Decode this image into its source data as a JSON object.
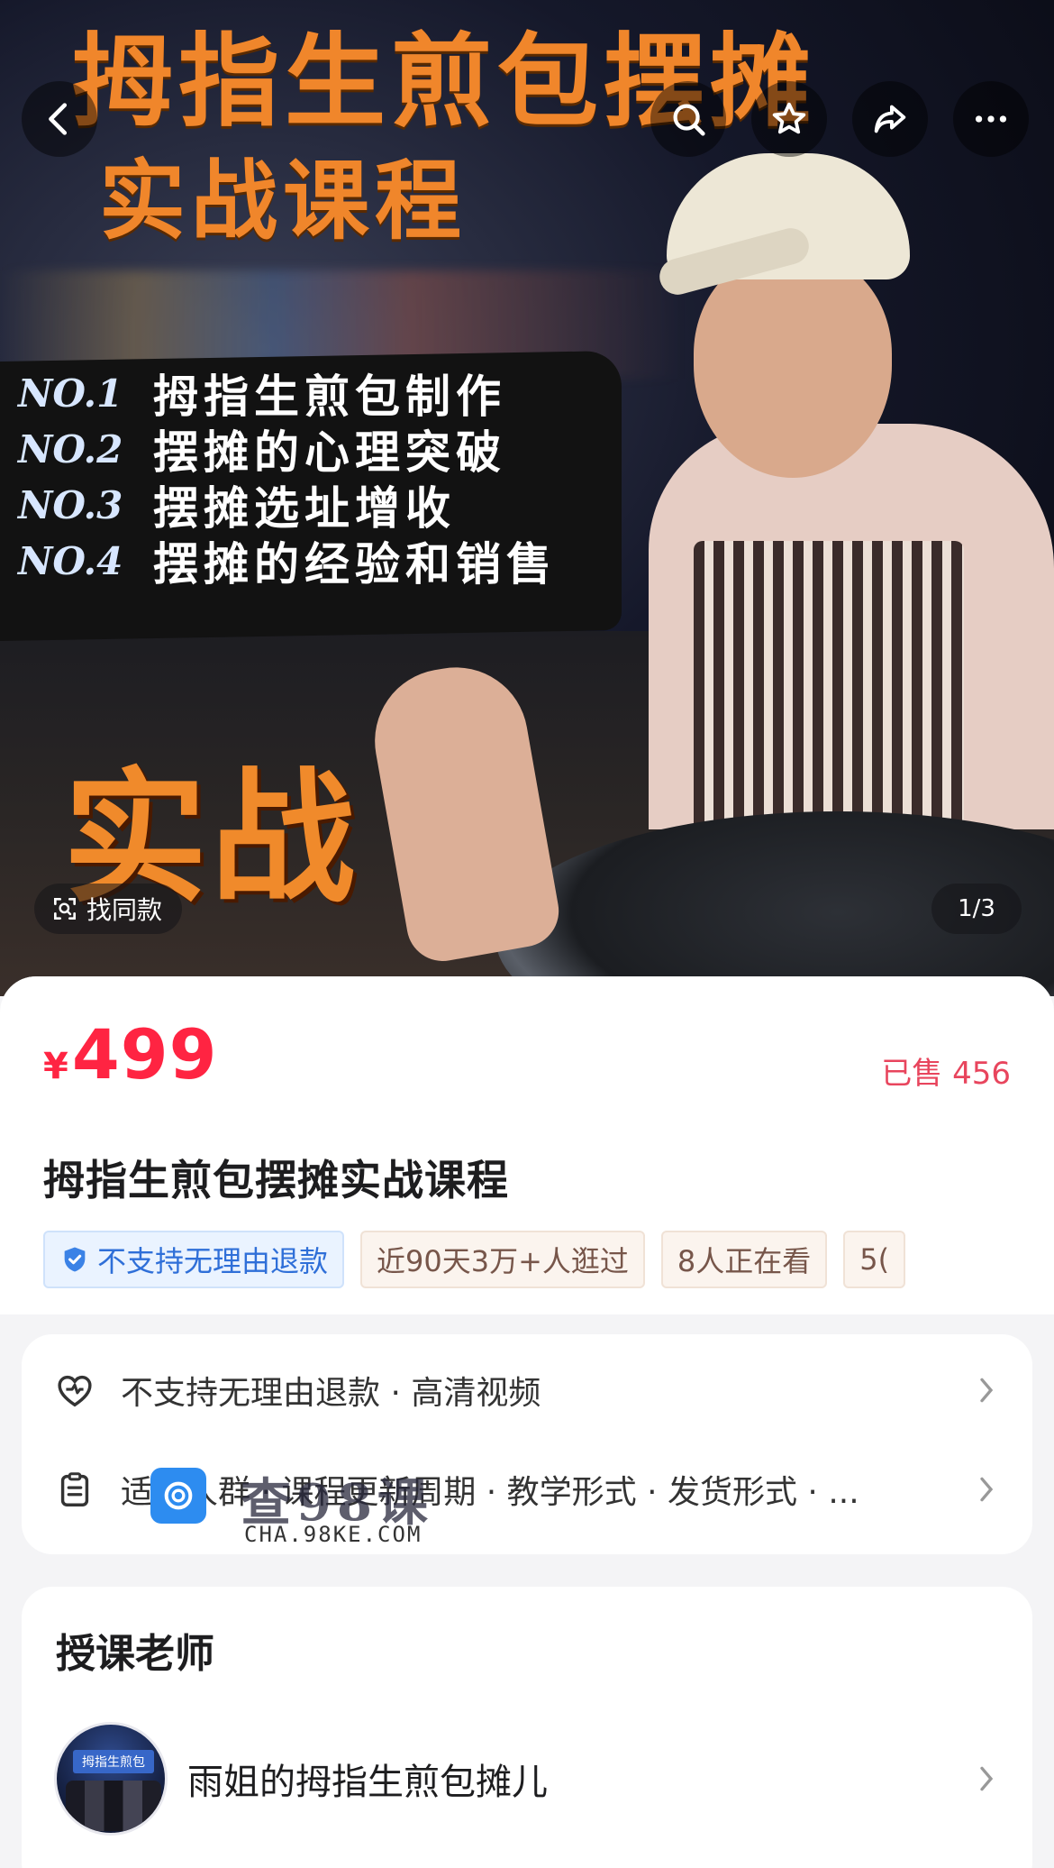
{
  "hero": {
    "title_line1": "拇指生煎包摆摊",
    "title_line2": "实战课程",
    "points": [
      {
        "no": "NO.1",
        "text": "拇指生煎包制作"
      },
      {
        "no": "NO.2",
        "text": "摆摊的心理突破"
      },
      {
        "no": "NO.3",
        "text": "摆摊选址增收"
      },
      {
        "no": "NO.4",
        "text": "摆摊的经验和销售"
      }
    ],
    "big_text": "实战",
    "find_same_label": "找同款",
    "pager": "1/3"
  },
  "product": {
    "currency": "¥",
    "price": "499",
    "sold": "已售 456",
    "title": "拇指生煎包摆摊实战课程",
    "tags": [
      {
        "text": "不支持无理由退款",
        "style": "blue"
      },
      {
        "text": "近90天3万+人逛过",
        "style": "warm"
      },
      {
        "text": "8人正在看",
        "style": "warm"
      },
      {
        "text": "5(",
        "style": "warm"
      }
    ]
  },
  "services": {
    "row1": "不支持无理由退款 · 高清视频",
    "row2": "适合人群 · 课程更新周期 · 教学形式 · 发货形式 · ..."
  },
  "teacher": {
    "heading": "授课老师",
    "name": "雨姐的拇指生煎包摊儿",
    "avatar_sign": "拇指生煎包"
  },
  "watermark": {
    "cn": "查98课",
    "en": "CHA.98KE.COM"
  },
  "colors": {
    "price_red": "#ff2442",
    "accent_orange": "#f0862b",
    "tag_blue": "#2f6fd8"
  },
  "icons": [
    "back-icon",
    "search-icon",
    "star-icon",
    "share-icon",
    "more-icon",
    "scan-icon",
    "shield-check-icon",
    "heart-shield-icon",
    "clipboard-icon",
    "chevron-right-icon"
  ]
}
